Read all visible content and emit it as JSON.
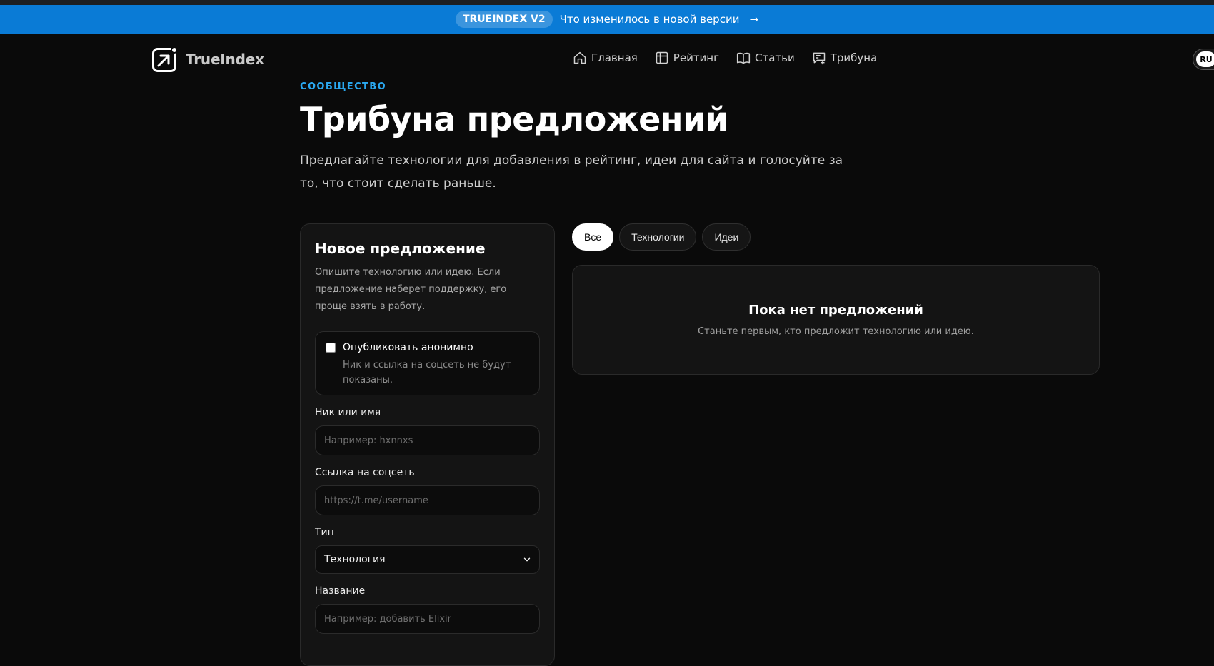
{
  "banner": {
    "badge": "TRUEINDEX V2",
    "text": "Что изменилось в новой версии",
    "arrow": "→"
  },
  "header": {
    "logo_text": "TrueIndex",
    "nav": [
      {
        "label": "Главная",
        "icon": "home-icon"
      },
      {
        "label": "Рейтинг",
        "icon": "table-icon"
      },
      {
        "label": "Статьи",
        "icon": "book-icon"
      },
      {
        "label": "Трибуна",
        "icon": "message-plus-icon"
      }
    ],
    "lang": "RU"
  },
  "hero": {
    "eyebrow": "СООБЩЕСТВО",
    "title": "Трибуна предложений",
    "description": "Предлагайте технологии для добавления в рейтинг, идеи для сайта и голосуйте за то, что стоит сделать раньше."
  },
  "form": {
    "title": "Новое предложение",
    "description": "Опишите технологию или идею. Если предложение наберет поддержку, его проще взять в работу.",
    "anonymous": {
      "label": "Опубликовать анонимно",
      "hint": "Ник и ссылка на соцсеть не будут показаны.",
      "checked": false
    },
    "nick": {
      "label": "Ник или имя",
      "placeholder": "Например: hxnnxs"
    },
    "social": {
      "label": "Ссылка на соцсеть",
      "placeholder": "https://t.me/username"
    },
    "type": {
      "label": "Тип",
      "value": "Технология"
    },
    "name": {
      "label": "Название",
      "placeholder": "Например: добавить Elixir"
    }
  },
  "filters": [
    {
      "label": "Все",
      "active": true
    },
    {
      "label": "Технологии",
      "active": false
    },
    {
      "label": "Идеи",
      "active": false
    }
  ],
  "empty": {
    "title": "Пока нет предложений",
    "subtitle": "Станьте первым, кто предложит технологию или идею."
  },
  "colors": {
    "banner": "#0a7bd6",
    "accent": "#2aa8f0",
    "background": "#0a0a0a",
    "card": "#141414"
  }
}
